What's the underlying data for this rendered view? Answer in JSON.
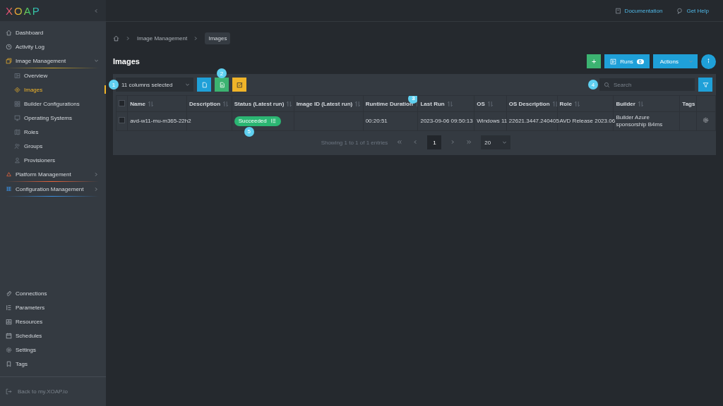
{
  "logo": "XOAP",
  "sidebar": {
    "items": [
      {
        "label": "Dashboard",
        "selected": false
      },
      {
        "label": "Activity Log",
        "selected": false
      },
      {
        "label": "Image Management",
        "selected": false,
        "expanded": true,
        "children": [
          {
            "label": "Overview",
            "selected": false
          },
          {
            "label": "Images",
            "selected": true
          },
          {
            "label": "Builder Configurations",
            "selected": false
          },
          {
            "label": "Operating Systems",
            "selected": false
          },
          {
            "label": "Roles",
            "selected": false
          },
          {
            "label": "Groups",
            "selected": false
          },
          {
            "label": "Provisioners",
            "selected": false
          }
        ]
      },
      {
        "label": "Platform Management",
        "selected": false,
        "expanded": false
      },
      {
        "label": "Configuration Management",
        "selected": false,
        "expanded": false
      }
    ],
    "bottom_items": [
      {
        "label": "Connections"
      },
      {
        "label": "Parameters"
      },
      {
        "label": "Resources"
      },
      {
        "label": "Schedules"
      },
      {
        "label": "Settings"
      },
      {
        "label": "Tags"
      }
    ],
    "back_link": "Back to my.XOAP.io"
  },
  "top_links": [
    "Documentation",
    "Get Help"
  ],
  "breadcrumb": [
    "Image Management",
    "Images"
  ],
  "page_title": "Images",
  "header_buttons": {
    "add": "+",
    "runs": "Runs",
    "runs_count": "0",
    "actions": "Actions"
  },
  "toolbar": {
    "columns_select": "11 columns selected",
    "search_placeholder": "Search"
  },
  "table": {
    "select_all_checked": false,
    "columns": [
      "Name",
      "Description",
      "Status (Latest run)",
      "Image ID (Latest run)",
      "Runtime Duration",
      "Last Run",
      "OS",
      "OS Description",
      "Role",
      "Builder",
      "Tags"
    ],
    "rows": [
      {
        "checked": false,
        "cells": [
          "avd-w11-mu-m365-22h2",
          "",
          "Succeeded",
          "",
          "00:20:51",
          "2023-09-06 09:50:13",
          "Windows 11",
          "22621.3447.240405",
          "AVD Release 2023.06",
          "Builder Azure sponsorship B4ms",
          ""
        ]
      }
    ]
  },
  "pagination": {
    "summary": "Showing 1 to 1 of 1 entries",
    "pages": [
      {
        "label": "1",
        "selected": true
      }
    ],
    "page_size": "20"
  },
  "callouts": [
    "1",
    "2",
    "3",
    "4",
    "5"
  ]
}
